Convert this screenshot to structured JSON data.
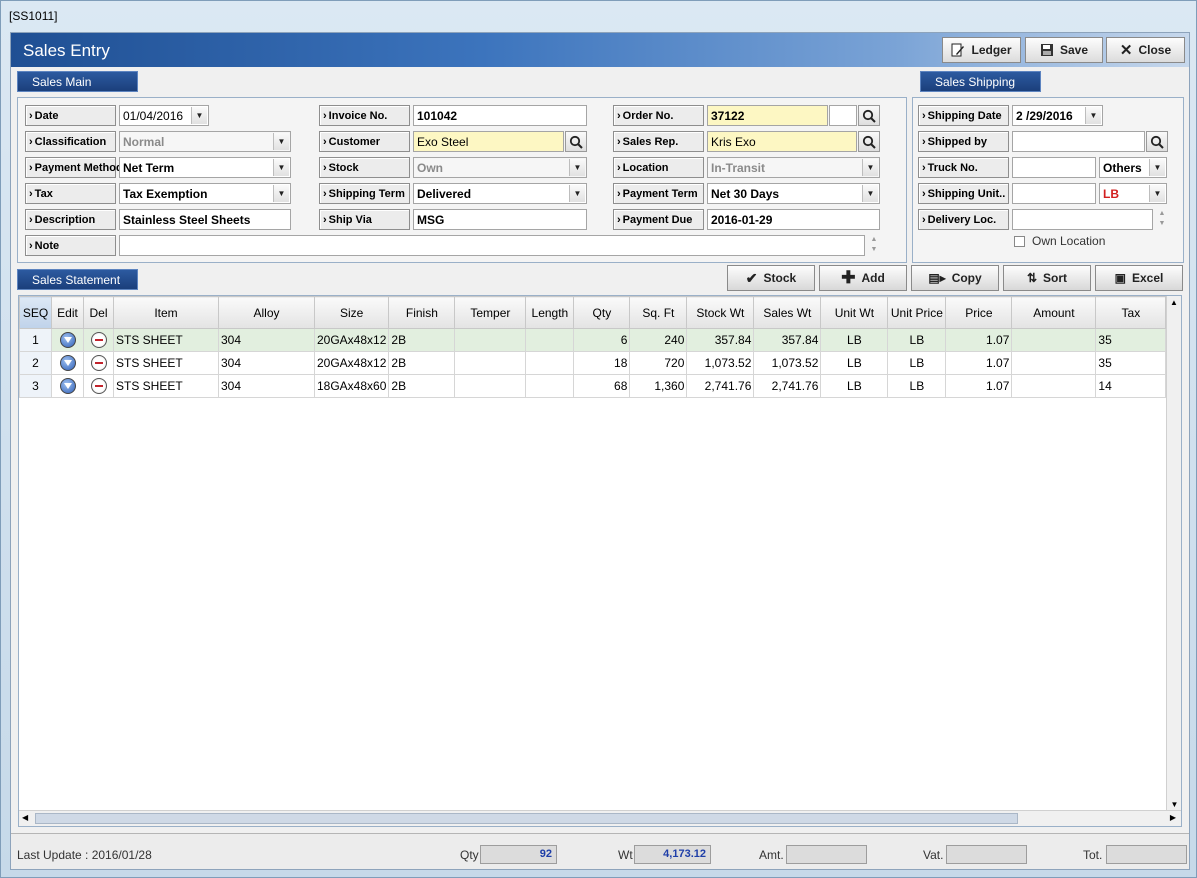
{
  "window_title": "[SS1011]",
  "title": "Sales Entry",
  "toolbar": {
    "ledger": "Ledger",
    "save": "Save",
    "close": "Close"
  },
  "sections": {
    "main": "Sales Main",
    "shipping": "Sales Shipping",
    "statement": "Sales Statement"
  },
  "main": {
    "date_label": "Date",
    "date": "01/04/2016",
    "classification_label": "Classification",
    "classification": "Normal",
    "payment_method_label": "Payment Method",
    "payment_method": "Net Term",
    "tax_label": "Tax",
    "tax": "Tax Exemption",
    "description_label": "Description",
    "description": "Stainless Steel Sheets",
    "note_label": "Note",
    "note": "",
    "invoice_label": "Invoice No.",
    "invoice": "101042",
    "customer_label": "Customer",
    "customer": "Exo Steel",
    "stock_label": "Stock",
    "stock": "Own",
    "shipping_term_label": "Shipping Term",
    "shipping_term": "Delivered",
    "ship_via_label": "Ship Via",
    "ship_via": "MSG",
    "order_label": "Order No.",
    "order": "37122",
    "sales_rep_label": "Sales Rep.",
    "sales_rep": "Kris Exo",
    "location_label": "Location",
    "location": "In-Transit",
    "payment_term_label": "Payment Term",
    "payment_term": "Net 30 Days",
    "payment_due_label": "Payment Due",
    "payment_due": "2016-01-29"
  },
  "shipping": {
    "date_label": "Shipping Date",
    "date": "2 /29/2016",
    "shipped_by_label": "Shipped by",
    "shipped_by": "",
    "truck_label": "Truck No.",
    "truck": "",
    "truck_type": "Others",
    "unit_label": "Shipping Unit..",
    "unit": "",
    "unit_type": "LB",
    "delivery_label": "Delivery Loc.",
    "delivery": "",
    "own_location": "Own Location"
  },
  "actions": {
    "stock": "Stock",
    "add": "Add",
    "copy": "Copy",
    "sort": "Sort",
    "excel": "Excel"
  },
  "columns": [
    "SEQ",
    "Edit",
    "Del",
    "Item",
    "Alloy",
    "Size",
    "Finish",
    "Temper",
    "Length",
    "Qty",
    "Sq. Ft",
    "Stock Wt",
    "Sales Wt",
    "Unit Wt",
    "Unit Price",
    "Price",
    "Amount",
    "Tax"
  ],
  "rows": [
    {
      "seq": "1",
      "item": "STS SHEET",
      "alloy": "304",
      "size": "20GAx48x12",
      "finish": "2B",
      "temper": "",
      "length": "",
      "qty": "6",
      "sqft": "240",
      "stock_wt": "357.84",
      "sales_wt": "357.84",
      "unit_wt": "LB",
      "unit_price": "LB",
      "price": "1.07",
      "amount": "",
      "tax": "35"
    },
    {
      "seq": "2",
      "item": "STS SHEET",
      "alloy": "304",
      "size": "20GAx48x12",
      "finish": "2B",
      "temper": "",
      "length": "",
      "qty": "18",
      "sqft": "720",
      "stock_wt": "1,073.52",
      "sales_wt": "1,073.52",
      "unit_wt": "LB",
      "unit_price": "LB",
      "price": "1.07",
      "amount": "",
      "tax": "35"
    },
    {
      "seq": "3",
      "item": "STS SHEET",
      "alloy": "304",
      "size": "18GAx48x60",
      "finish": "2B",
      "temper": "",
      "length": "",
      "qty": "68",
      "sqft": "1,360",
      "stock_wt": "2,741.76",
      "sales_wt": "2,741.76",
      "unit_wt": "LB",
      "unit_price": "LB",
      "price": "1.07",
      "amount": "",
      "tax": "14"
    }
  ],
  "footer": {
    "last_update": "Last Update : 2016/01/28",
    "qty_label": "Qty",
    "qty": "92",
    "wt_label": "Wt",
    "wt": "4,173.12",
    "amt_label": "Amt.",
    "amt": "",
    "vat_label": "Vat.",
    "vat": "",
    "tot_label": "Tot.",
    "tot": ""
  }
}
